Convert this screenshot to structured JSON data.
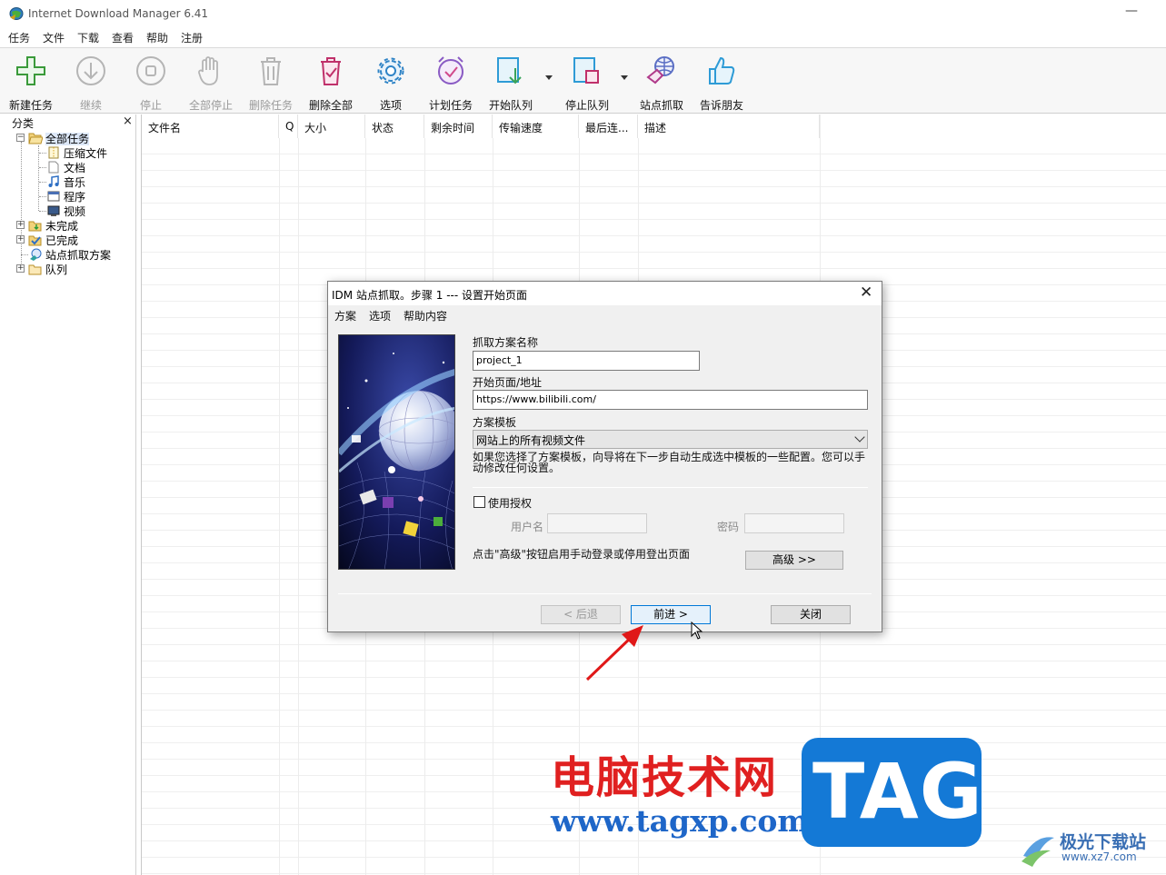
{
  "window": {
    "title": "Internet Download Manager 6.41",
    "minimize_glyph": "—"
  },
  "menu": [
    "任务",
    "文件",
    "下载",
    "查看",
    "帮助",
    "注册"
  ],
  "toolbar": {
    "buttons": [
      {
        "label": "新建任务",
        "icon": "plus-icon",
        "enabled": true
      },
      {
        "label": "继续",
        "icon": "download-circle-icon",
        "enabled": false
      },
      {
        "label": "停止",
        "icon": "stop-circle-icon",
        "enabled": false
      },
      {
        "label": "全部停止",
        "icon": "hand-icon",
        "enabled": false
      },
      {
        "label": "删除任务",
        "icon": "trash-icon",
        "enabled": false
      },
      {
        "label": "删除全部",
        "icon": "trash-all-icon",
        "enabled": true
      },
      {
        "label": "选项",
        "icon": "gear-icon",
        "enabled": true
      },
      {
        "label": "计划任务",
        "icon": "alarm-clock-icon",
        "enabled": true
      },
      {
        "label": "开始队列",
        "icon": "queue-start-icon",
        "enabled": true
      },
      {
        "label": "停止队列",
        "icon": "queue-stop-icon",
        "enabled": true
      },
      {
        "label": "站点抓取",
        "icon": "site-grabber-icon",
        "enabled": true
      },
      {
        "label": "告诉朋友",
        "icon": "thumbs-up-icon",
        "enabled": true
      }
    ]
  },
  "sidebar": {
    "header": "分类",
    "close_glyph": "×",
    "all_tasks": "全部任务",
    "children": [
      "压缩文件",
      "文档",
      "音乐",
      "程序",
      "视频"
    ],
    "top_items": [
      "未完成",
      "已完成",
      "站点抓取方案",
      "队列"
    ]
  },
  "grid": {
    "columns": [
      "文件名",
      "Q",
      "大小",
      "状态",
      "剩余时间",
      "传输速度",
      "最后连...",
      "描述"
    ]
  },
  "dialog": {
    "title": "IDM 站点抓取。步骤 1 --- 设置开始页面",
    "close_glyph": "✕",
    "menu": [
      "方案",
      "选项",
      "帮助内容"
    ],
    "project_name_label": "抓取方案名称",
    "project_name_value": "project_1",
    "start_page_label": "开始页面/地址",
    "start_page_value": "https://www.bilibili.com/",
    "template_label": "方案模板",
    "template_value": "网站上的所有视频文件",
    "template_hint_line1": "如果您选择了方案模板，向导将在下一步自动生成选中模板的一些配置。您可以手",
    "template_hint_line2": "动修改任何设置。",
    "use_auth_label": "使用授权",
    "use_auth_checked": false,
    "username_label": "用户名",
    "password_label": "密码",
    "advanced_hint": "点击\"高级\"按钮启用手动登录或停用登出页面",
    "advanced_button": "高级 >>",
    "back_button": "< 后退",
    "next_button": "前进 >",
    "close_button": "关闭"
  },
  "watermark": {
    "chinese": "电脑技术网",
    "url": "www.tagxp.com",
    "tag": "TAG",
    "site_name": "极光下载站",
    "site_url": "www.xz7.com"
  },
  "colors": {
    "accent": "#0078d7",
    "toolbar_icon": "#2e9bd6",
    "arrow": "#e01818",
    "watermark_red": "#e02020",
    "watermark_blue": "#1479d6"
  }
}
